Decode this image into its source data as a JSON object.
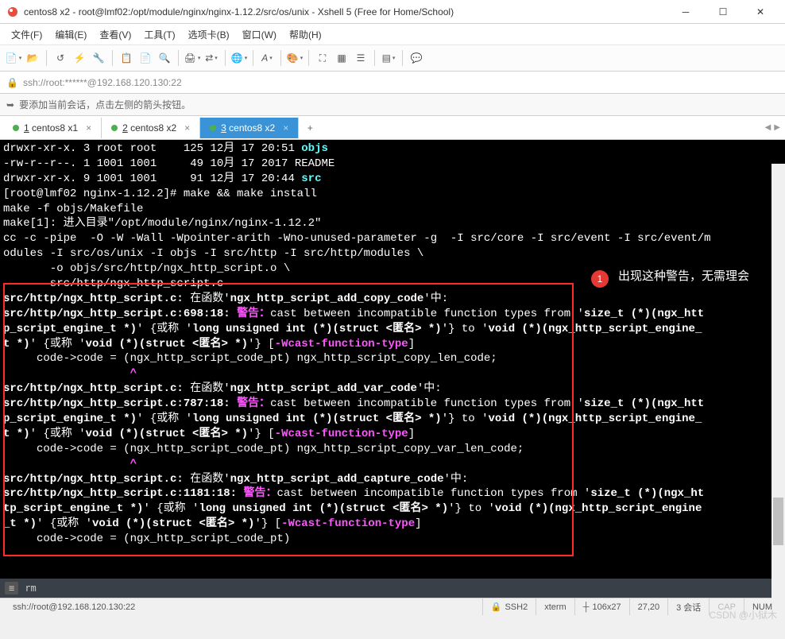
{
  "window": {
    "title": "centos8 x2 - root@lmf02:/opt/module/nginx/nginx-1.12.2/src/os/unix - Xshell 5 (Free for Home/School)"
  },
  "menu": {
    "file": "文件(F)",
    "edit": "编辑(E)",
    "view": "查看(V)",
    "tools": "工具(T)",
    "tabs": "选项卡(B)",
    "window": "窗口(W)",
    "help": "帮助(H)"
  },
  "addr": {
    "lock": "🔒",
    "url": "ssh://root:******@192.168.120.130:22"
  },
  "info": {
    "arrow": "➥",
    "text": "要添加当前会话，点击左侧的箭头按钮。"
  },
  "tabs": [
    {
      "label": "1 centos8 x1",
      "underline": "1",
      "active": false
    },
    {
      "label": "2 centos8 x2",
      "underline": "2",
      "active": false
    },
    {
      "label": "3 centos8 x2",
      "underline": "3",
      "active": true
    }
  ],
  "terminal": {
    "objs_line": {
      "perm": "drwxr-xr-x. 3 root root    125 12月 17 20:51 ",
      "name": "objs"
    },
    "readme_line": "-rw-r--r--. 1 1001 1001     49 10月 17 2017 README",
    "src_line": {
      "perm": "drwxr-xr-x. 9 1001 1001     91 12月 17 20:44 ",
      "name": "src"
    },
    "prompt_line": "[root@lmf02 nginx-1.12.2]# make && make install",
    "make_lines": [
      "make -f objs/Makefile",
      "make[1]: 进入目录\"/opt/module/nginx/nginx-1.12.2\"",
      "cc -c -pipe  -O -W -Wall -Wpointer-arith -Wno-unused-parameter -g  -I src/core -I src/event -I src/event/m",
      "odules -I src/os/unix -I objs -I src/http -I src/http/modules \\",
      "       -o objs/src/http/ngx_http_script.o \\",
      "       src/http/ngx_http_script.c"
    ],
    "func1": "ngx_http_script_add_copy_code",
    "func2": "ngx_http_script_add_var_code",
    "func3": "ngx_http_script_add_capture_code",
    "loc1": "src/http/ngx_http_script.c:698:18: ",
    "loc2": "src/http/ngx_http_script.c:787:18: ",
    "loc3": "src/http/ngx_http_script.c:1181:18: ",
    "warn": "警告：",
    "castmsg": "cast between incompatible function types from '",
    "type1": "size_t (*)(ngx_htt",
    "type1b": "p_script_engine_t *)",
    "type2a": "size_t (*)(ngx_htt",
    "type2b": "p_script_engine_t *)",
    "type3a": "size_t (*)(ngx_ht",
    "type3b": "tp_script_engine_t *)",
    "alias": "' {或称 '",
    "longtype": "long unsigned int (*)(struct <匿名> *)",
    "to": "'} to '",
    "void1a": "void (*)(ngx_http_script_engine_",
    "void1b": "t *)",
    "void2a": "void (*)(ngx_http_script_engine_",
    "void2b": "t *)",
    "void3a": "void (*)(ngx_http_script_engine",
    "void3b": "_t *)",
    "voidstruct": "void (*)(struct <匿名> *)",
    "wcast": "-Wcast-function-type",
    "code1": "     code->code = (ngx_http_script_code_pt) ngx_http_script_copy_len_code;",
    "caret": "                   ^",
    "code2": "     code->code = (ngx_http_script_code_pt) ngx_http_script_copy_var_len_code;",
    "code3": "     code->code = (ngx_http_script_code_pt)",
    "in_func": " 在函数'",
    "in_func_end": "'中:",
    "file": "src/http/ngx_http_script.c:"
  },
  "annotation": {
    "num": "1",
    "text": "出现这种警告，无需理会"
  },
  "cmdbar": {
    "prompt": "≡",
    "cmd": "rm"
  },
  "status": {
    "left": "ssh://root@192.168.120.130:22",
    "ssh": "SSH2",
    "term": "xterm",
    "size": "106x27",
    "pos": "27,20",
    "sess": "3 会话",
    "cap": "CAP",
    "num": "NUM"
  },
  "watermark": "CSDN @小狱木"
}
